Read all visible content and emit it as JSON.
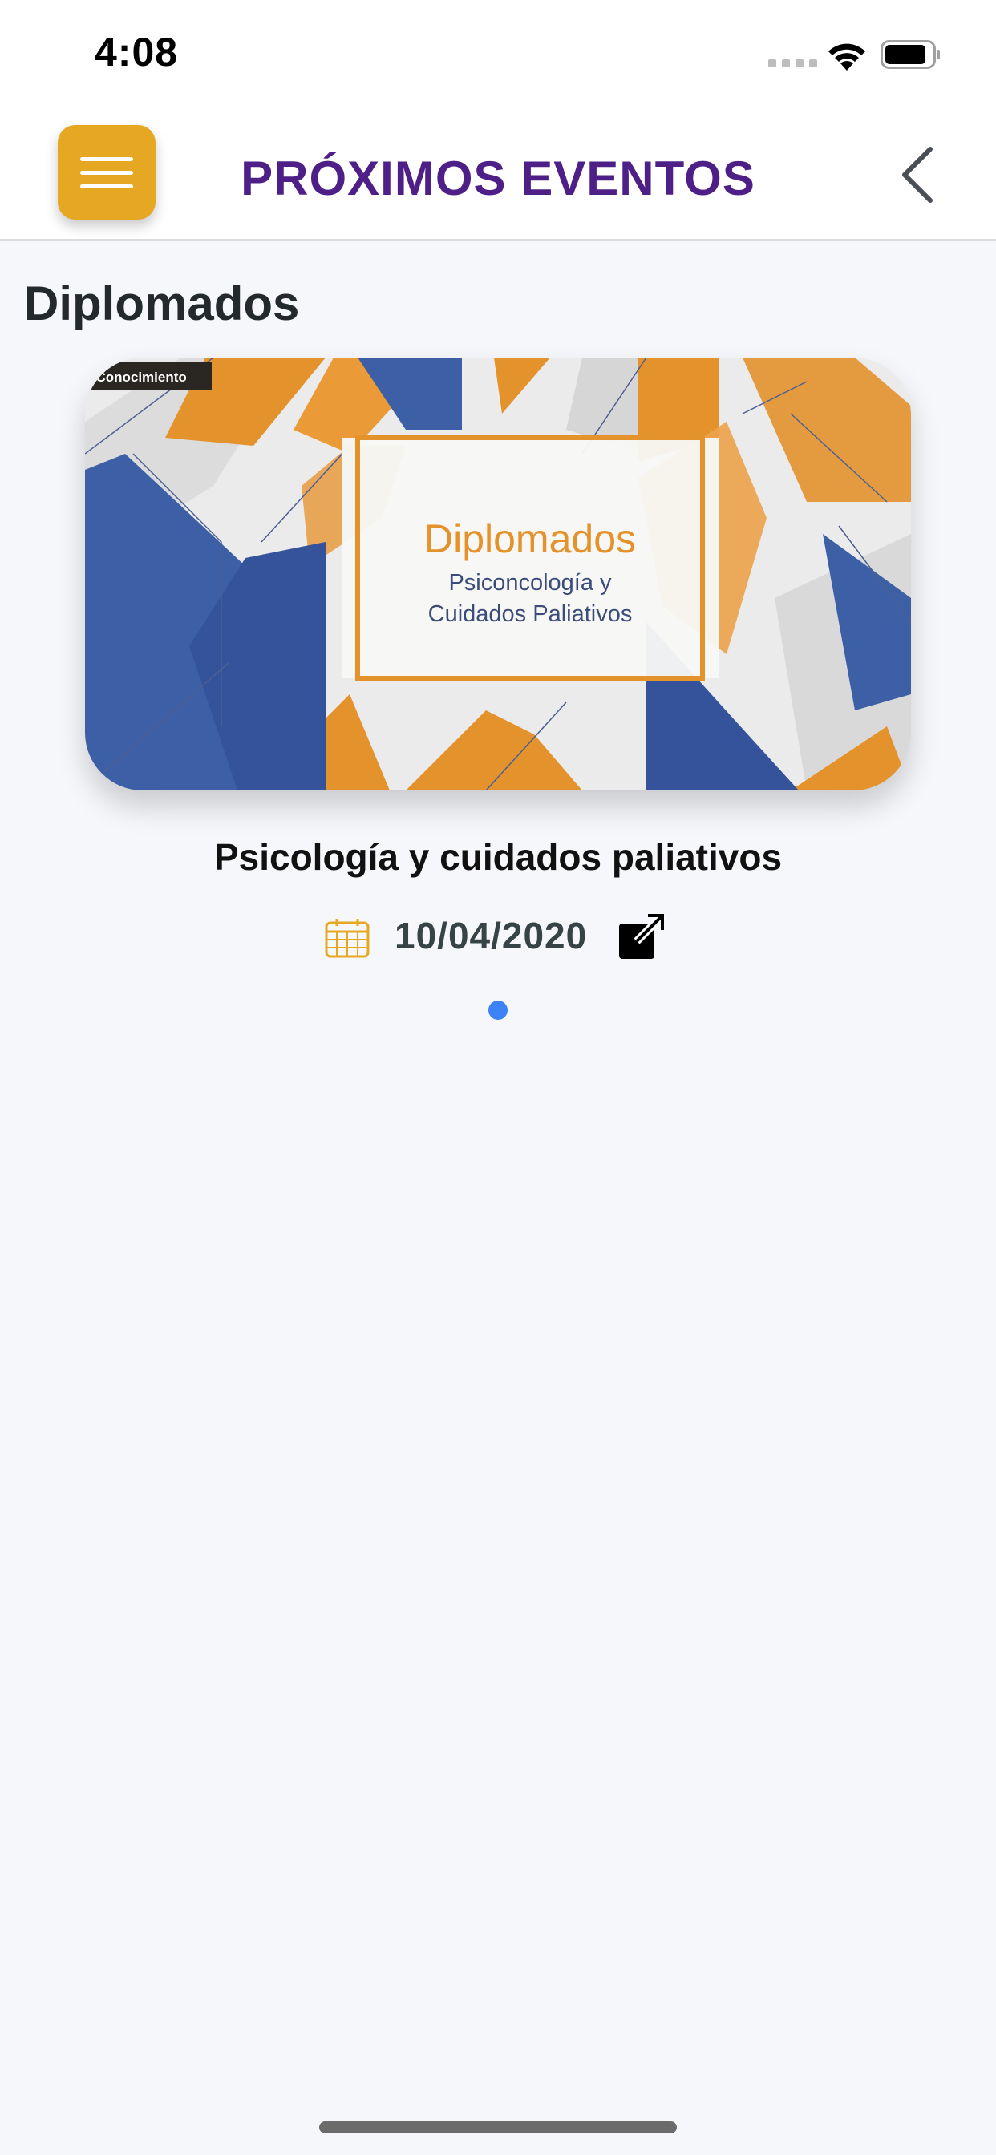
{
  "status_bar": {
    "time": "4:08"
  },
  "header": {
    "title": "PRÓXIMOS EVENTOS",
    "menu_icon": "hamburger-icon",
    "back_icon": "chevron-left-icon"
  },
  "section": {
    "title": "Diplomados"
  },
  "event": {
    "banner": {
      "corner_tag": "l Conocimiento",
      "heading": "Diplomados",
      "line1": "Psiconcología y",
      "line2": "Cuidados Paliativos"
    },
    "title": "Psicología y cuidados paliativos",
    "date": "10/04/2020",
    "date_icon": "calendar-icon",
    "open_icon": "external-link-icon"
  },
  "pager": {
    "pages": 1,
    "current": 1
  },
  "colors": {
    "accent_yellow": "#e6a823",
    "title_purple": "#4e1f86",
    "pager_blue": "#3e82f7",
    "banner_orange": "#e3922c",
    "banner_blue": "#3c5fa6"
  }
}
